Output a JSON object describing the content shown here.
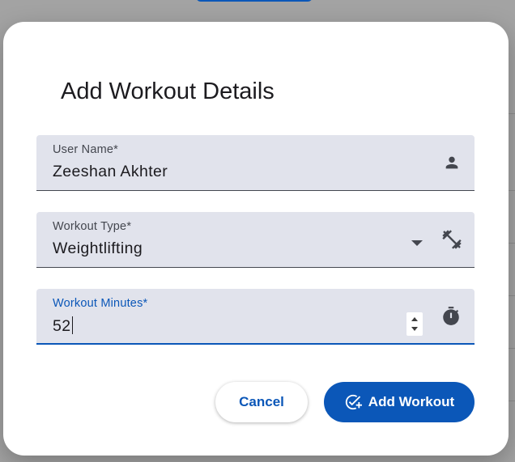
{
  "dialog": {
    "title": "Add Workout Details",
    "fields": {
      "user_name": {
        "label": "User Name*",
        "value": "Zeeshan Akhter",
        "icon": "person-icon"
      },
      "workout_type": {
        "label": "Workout Type*",
        "value": "Weightlifting",
        "icon": "dumbbell-icon"
      },
      "workout_minutes": {
        "label": "Workout Minutes*",
        "value": "52",
        "icon": "timer-icon"
      }
    },
    "buttons": {
      "cancel": "Cancel",
      "add": "Add Workout"
    }
  },
  "colors": {
    "primary": "#0b57b8",
    "field_bg": "#e1e3ec",
    "overlay": "#a3a3a3"
  }
}
